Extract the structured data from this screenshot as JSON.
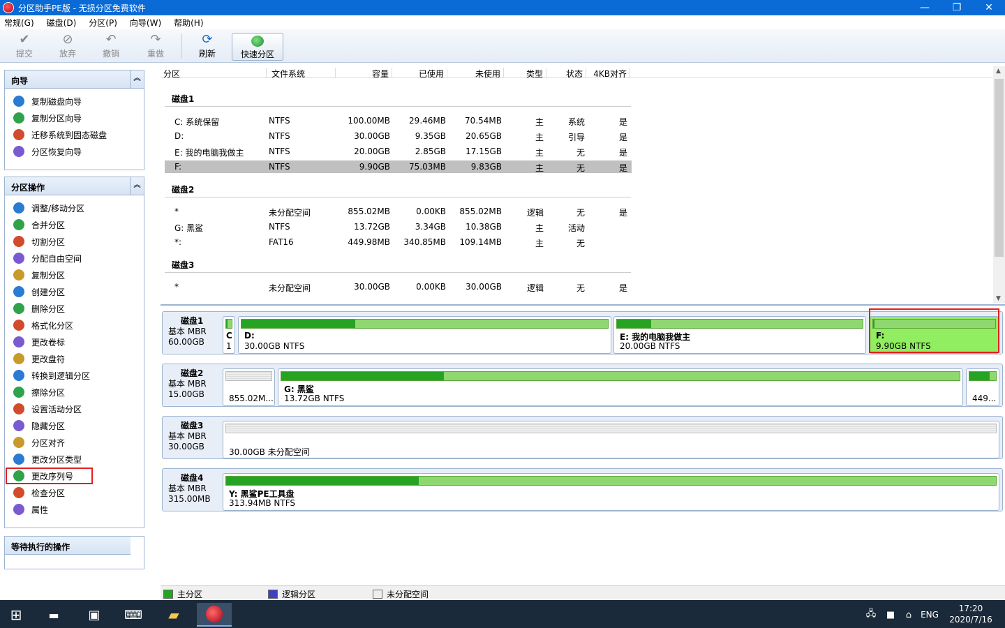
{
  "window": {
    "title": "分区助手PE版 - 无损分区免费软件",
    "minimize": "—",
    "maximize": "❐",
    "close": "✕"
  },
  "menu": [
    "常规(G)",
    "磁盘(D)",
    "分区(P)",
    "向导(W)",
    "帮助(H)"
  ],
  "toolbar": {
    "commit": "提交",
    "discard": "放弃",
    "undo": "撤销",
    "redo": "重做",
    "refresh": "刷新",
    "quick": "快速分区"
  },
  "wizard_panel": {
    "title": "向导",
    "items": [
      "复制磁盘向导",
      "复制分区向导",
      "迁移系统到固态磁盘",
      "分区恢复向导"
    ]
  },
  "ops_panel": {
    "title": "分区操作",
    "items": [
      "调整/移动分区",
      "合并分区",
      "切割分区",
      "分配自由空间",
      "复制分区",
      "创建分区",
      "删除分区",
      "格式化分区",
      "更改卷标",
      "更改盘符",
      "转换到逻辑分区",
      "擦除分区",
      "设置活动分区",
      "隐藏分区",
      "分区对齐",
      "更改分区类型",
      "更改序列号",
      "检查分区",
      "属性"
    ]
  },
  "pending_panel": {
    "title": "等待执行的操作"
  },
  "list": {
    "headers": [
      "分区",
      "文件系统",
      "容量",
      "已使用",
      "未使用",
      "类型",
      "状态",
      "4KB对齐"
    ],
    "disks": [
      {
        "label": "磁盘1",
        "rows": [
          [
            "C: 系统保留",
            "NTFS",
            "100.00MB",
            "29.46MB",
            "70.54MB",
            "主",
            "系统",
            "是"
          ],
          [
            "D:",
            "NTFS",
            "30.00GB",
            "9.35GB",
            "20.65GB",
            "主",
            "引导",
            "是"
          ],
          [
            "E: 我的电脑我做主",
            "NTFS",
            "20.00GB",
            "2.85GB",
            "17.15GB",
            "主",
            "无",
            "是"
          ],
          [
            "F:",
            "NTFS",
            "9.90GB",
            "75.03MB",
            "9.83GB",
            "主",
            "无",
            "是"
          ]
        ]
      },
      {
        "label": "磁盘2",
        "rows": [
          [
            "*",
            "未分配空间",
            "855.02MB",
            "0.00KB",
            "855.02MB",
            "逻辑",
            "无",
            "是"
          ],
          [
            "G: 黑鲨",
            "NTFS",
            "13.72GB",
            "3.34GB",
            "10.38GB",
            "主",
            "活动",
            ""
          ],
          [
            "*:",
            "FAT16",
            "449.98MB",
            "340.85MB",
            "109.14MB",
            "主",
            "无",
            ""
          ]
        ]
      },
      {
        "label": "磁盘3",
        "rows": [
          [
            "*",
            "未分配空间",
            "30.00GB",
            "0.00KB",
            "30.00GB",
            "逻辑",
            "无",
            "是"
          ]
        ]
      }
    ]
  },
  "maps": [
    {
      "name": "磁盘1",
      "type": "基本 MBR",
      "size": "60.00GB",
      "parts": [
        {
          "name": "C",
          "size": "1"
        },
        {
          "name": "D:",
          "size": "30.00GB NTFS"
        },
        {
          "name": "E: 我的电脑我做主",
          "size": "20.00GB NTFS"
        },
        {
          "name": "F:",
          "size": "9.90GB NTFS"
        }
      ]
    },
    {
      "name": "磁盘2",
      "type": "基本 MBR",
      "size": "15.00GB",
      "parts": [
        {
          "name": "",
          "size": "855.02M..."
        },
        {
          "name": "G: 黑鲨",
          "size": "13.72GB NTFS"
        },
        {
          "name": "",
          "size": "449..."
        }
      ]
    },
    {
      "name": "磁盘3",
      "type": "基本 MBR",
      "size": "30.00GB",
      "parts": [
        {
          "name": "",
          "size": "30.00GB 未分配空间"
        }
      ]
    },
    {
      "name": "磁盘4",
      "type": "基本 MBR",
      "size": "315.00MB",
      "parts": [
        {
          "name": "Y: 黑鲨PE工具盘",
          "size": "313.94MB NTFS"
        }
      ]
    }
  ],
  "legend": {
    "primary": "主分区",
    "logical": "逻辑分区",
    "unalloc": "未分配空间"
  },
  "taskbar": {
    "lang": "ENG",
    "time": "17:20",
    "date": "2020/7/16"
  },
  "colors": {
    "primary": "#26a322",
    "primary_light": "#8fd86f",
    "logical": "#4040c0",
    "highlight": "#e02020"
  }
}
